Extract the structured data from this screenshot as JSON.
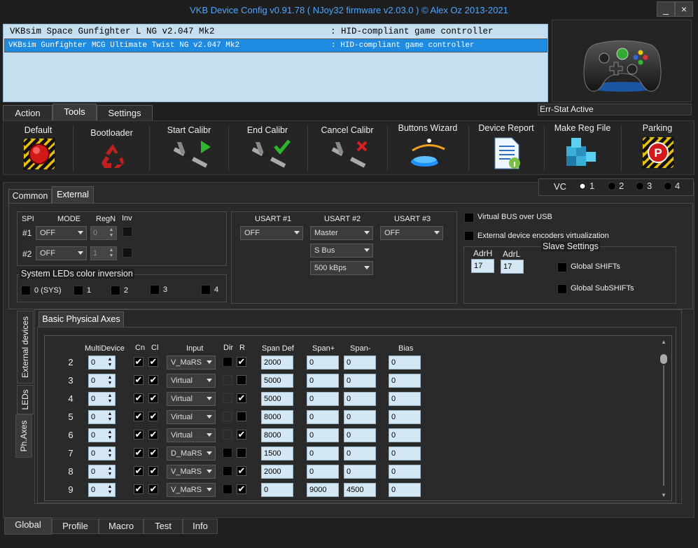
{
  "window": {
    "title": "VKB Device Config v0.91.78 ( NJoy32 firmware v2.03.0 ) © Alex Oz 2013-2021",
    "minimize": "_",
    "close": "×"
  },
  "devices": [
    {
      "name": "VKBsim Space Gunfighter L NG v2.047 Mk2",
      "type": ": HID-compliant game controller",
      "selected": false
    },
    {
      "name": "VKBsim Gunfighter MCG Ultimate Twist NG v2.047 Mk2",
      "type": ": HID-compliant game controller",
      "selected": true
    }
  ],
  "err_stat": "Err-Stat Active",
  "top_tabs": [
    "Action",
    "Tools",
    "Settings"
  ],
  "tools": [
    {
      "label": "Default",
      "icon": "red-button-icon"
    },
    {
      "label": "Bootloader",
      "icon": "recycle-icon"
    },
    {
      "label": "Start Calibr",
      "icon": "caliper-play-icon"
    },
    {
      "label": "End Calibr",
      "icon": "caliper-check-icon"
    },
    {
      "label": "Cancel Calibr",
      "icon": "caliper-cancel-icon"
    },
    {
      "label": "Buttons Wizard",
      "icon": "wizard-icon"
    },
    {
      "label": "Device Report",
      "icon": "report-icon"
    },
    {
      "label": "Make Reg File",
      "icon": "registry-icon"
    },
    {
      "label": "Parking",
      "icon": "parking-icon"
    }
  ],
  "sub_tabs": [
    "Common",
    "External"
  ],
  "vc": {
    "label": "VC",
    "options": [
      "1",
      "2",
      "3",
      "4"
    ],
    "selected": "1"
  },
  "spi": {
    "headers": [
      "SPI",
      "MODE",
      "RegN",
      "Inv"
    ],
    "rows": [
      {
        "label": "#1",
        "mode": "OFF",
        "regn": "0"
      },
      {
        "label": "#2",
        "mode": "OFF",
        "regn": "1"
      }
    ]
  },
  "leds_inv": {
    "title": "System LEDs color inversion",
    "items": [
      "0 (SYS)",
      "1",
      "2",
      "3",
      "4"
    ]
  },
  "usart": {
    "headers": [
      "USART #1",
      "USART #2",
      "USART #3"
    ],
    "u1": "OFF",
    "u2": [
      "Master",
      "S Bus",
      "500 kBps"
    ],
    "u3": "OFF"
  },
  "virtual_bus": "Virtual BUS over USB",
  "ext_encoders": "External device encoders virtualization",
  "slave": {
    "title": "Slave Settings",
    "adrh_label": "AdrH",
    "adrh": "17",
    "adrl_label": "AdrL",
    "adrl": "17",
    "global_shifts": "Global SHIFTs",
    "global_subshifts": "Global SubSHIFTs"
  },
  "side_tabs": [
    "External devices",
    "LEDs",
    "Ph.Axes"
  ],
  "axes_tab": "Basic Physical Axes",
  "axes": {
    "headers": [
      "MultiDevice",
      "Cn",
      "Cl",
      "Input",
      "Dir",
      "R",
      "Span Def",
      "Span+",
      "Span-",
      "Bias"
    ],
    "rows": [
      {
        "n": "2",
        "md": "0",
        "cn": true,
        "cl": true,
        "input": "V_MaRS",
        "dir": false,
        "dir_dim": false,
        "r": true,
        "spandef": "2000",
        "spanp": "0",
        "spanm": "0",
        "bias": "0"
      },
      {
        "n": "3",
        "md": "0",
        "cn": true,
        "cl": true,
        "input": "Virtual",
        "dir": false,
        "dir_dim": true,
        "r": false,
        "spandef": "5000",
        "spanp": "0",
        "spanm": "0",
        "bias": "0"
      },
      {
        "n": "4",
        "md": "0",
        "cn": true,
        "cl": true,
        "input": "Virtual",
        "dir": false,
        "dir_dim": true,
        "r": true,
        "spandef": "5000",
        "spanp": "0",
        "spanm": "0",
        "bias": "0"
      },
      {
        "n": "5",
        "md": "0",
        "cn": true,
        "cl": true,
        "input": "Virtual",
        "dir": false,
        "dir_dim": true,
        "r": false,
        "spandef": "8000",
        "spanp": "0",
        "spanm": "0",
        "bias": "0"
      },
      {
        "n": "6",
        "md": "0",
        "cn": true,
        "cl": true,
        "input": "Virtual",
        "dir": false,
        "dir_dim": true,
        "r": true,
        "spandef": "8000",
        "spanp": "0",
        "spanm": "0",
        "bias": "0"
      },
      {
        "n": "7",
        "md": "0",
        "cn": true,
        "cl": true,
        "input": "D_MaRS",
        "dir": false,
        "dir_dim": false,
        "r": false,
        "spandef": "1500",
        "spanp": "0",
        "spanm": "0",
        "bias": "0"
      },
      {
        "n": "8",
        "md": "0",
        "cn": true,
        "cl": true,
        "input": "V_MaRS",
        "dir": false,
        "dir_dim": false,
        "r": true,
        "spandef": "2000",
        "spanp": "0",
        "spanm": "0",
        "bias": "0"
      },
      {
        "n": "9",
        "md": "0",
        "cn": true,
        "cl": true,
        "input": "V_MaRS",
        "dir": false,
        "dir_dim": false,
        "r": true,
        "spandef": "0",
        "spanp": "9000",
        "spanm": "4500",
        "bias": "0"
      }
    ]
  },
  "bottom_tabs": [
    "Global",
    "Profile",
    "Macro",
    "Test",
    "Info"
  ],
  "colors": {
    "title": "#4ea6ff",
    "selection": "#1e8ae0",
    "list_bg": "#c6dff0",
    "field_bg": "#d4e7f5"
  }
}
